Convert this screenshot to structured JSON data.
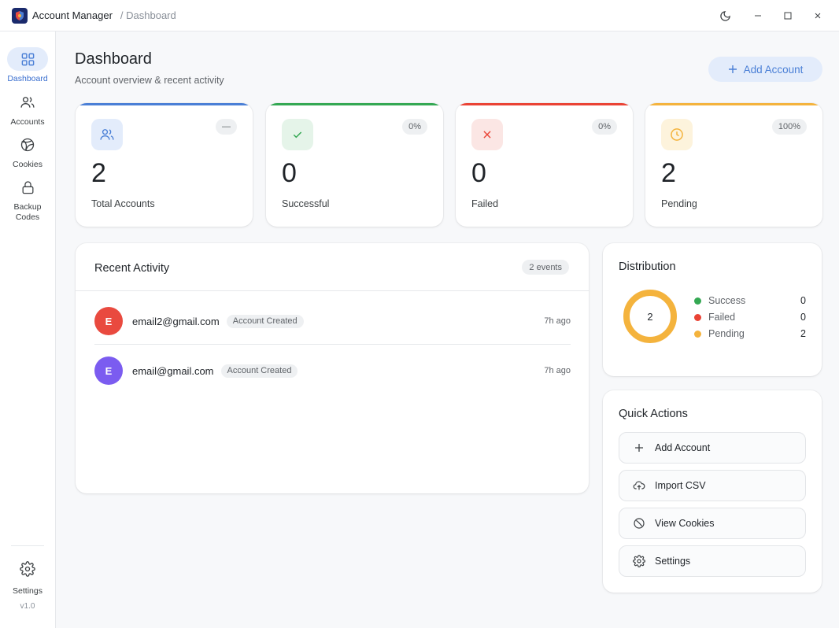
{
  "titlebar": {
    "app_title": "Account Manager",
    "breadcrumb": "/ Dashboard"
  },
  "sidebar": {
    "items": [
      {
        "label": "Dashboard",
        "icon": "grid-icon",
        "active": true
      },
      {
        "label": "Accounts",
        "icon": "users-icon"
      },
      {
        "label": "Cookies",
        "icon": "cookie-icon"
      },
      {
        "label": "Backup Codes",
        "icon": "lock-icon"
      }
    ],
    "settings_label": "Settings",
    "version": "v1.0"
  },
  "header": {
    "title": "Dashboard",
    "subtitle": "Account overview & recent activity",
    "add_button": "Add Account"
  },
  "stats": [
    {
      "value": "2",
      "label": "Total Accounts",
      "badge": "—",
      "color": "#4a7fd6",
      "icon": "users-icon"
    },
    {
      "value": "0",
      "label": "Successful",
      "badge": "0%",
      "color": "#34a853",
      "icon": "check-icon"
    },
    {
      "value": "0",
      "label": "Failed",
      "badge": "0%",
      "color": "#ea4335",
      "icon": "x-icon"
    },
    {
      "value": "2",
      "label": "Pending",
      "badge": "100%",
      "color": "#f4b33d",
      "icon": "clock-icon"
    }
  ],
  "recent": {
    "title": "Recent Activity",
    "badge": "2 events",
    "rows": [
      {
        "initial": "E",
        "email": "email2@gmail.com",
        "tag": "Account Created",
        "time": "7h ago",
        "avatar_color": "#e94a3f"
      },
      {
        "initial": "E",
        "email": "email@gmail.com",
        "tag": "Account Created",
        "time": "7h ago",
        "avatar_color": "#7b5cf0"
      }
    ]
  },
  "distribution": {
    "title": "Distribution",
    "center": "2",
    "legend": [
      {
        "label": "Success",
        "value": "0",
        "color": "#34a853"
      },
      {
        "label": "Failed",
        "value": "0",
        "color": "#ea4335"
      },
      {
        "label": "Pending",
        "value": "2",
        "color": "#f4b33d"
      }
    ]
  },
  "quick_actions": {
    "title": "Quick Actions",
    "items": [
      {
        "label": "Add Account",
        "icon": "plus-icon"
      },
      {
        "label": "Import CSV",
        "icon": "upload-cloud-icon"
      },
      {
        "label": "View Cookies",
        "icon": "cookie-icon"
      },
      {
        "label": "Settings",
        "icon": "gear-icon"
      }
    ]
  },
  "colors": {
    "accent": "#4a7fd6",
    "success": "#34a853",
    "failed": "#ea4335",
    "pending": "#f4b33d"
  }
}
